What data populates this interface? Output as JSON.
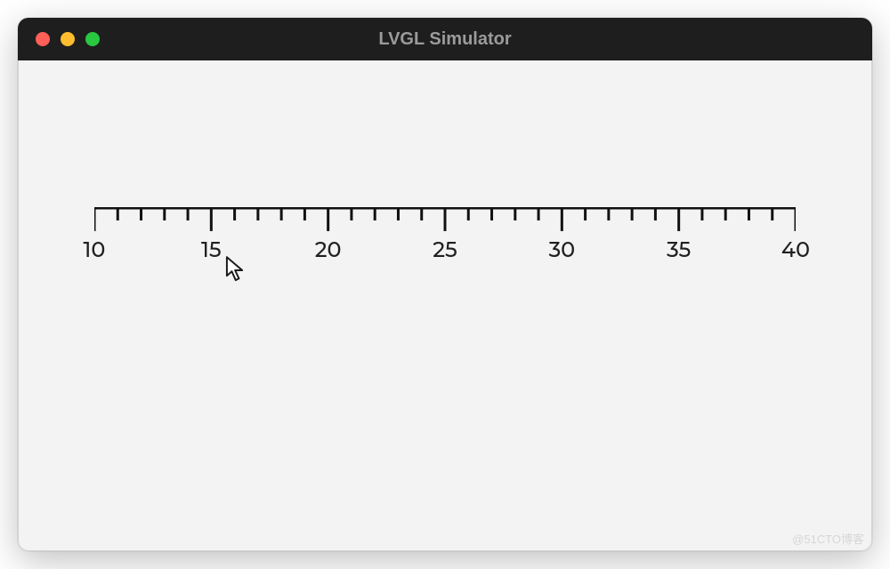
{
  "window": {
    "title": "LVGL Simulator"
  },
  "scale": {
    "min": 10,
    "max": 40,
    "major_interval": 5,
    "minor_interval": 1,
    "labels": [
      "10",
      "15",
      "20",
      "25",
      "30",
      "35",
      "40"
    ]
  },
  "cursor": {
    "visible": true
  },
  "watermark": "@51CTO博客",
  "chart_data": {
    "type": "scale",
    "title": "",
    "xlabel": "",
    "ylabel": "",
    "min": 10,
    "max": 40,
    "major_ticks": [
      10,
      15,
      20,
      25,
      30,
      35,
      40
    ],
    "minor_tick_step": 1,
    "orientation": "horizontal"
  }
}
